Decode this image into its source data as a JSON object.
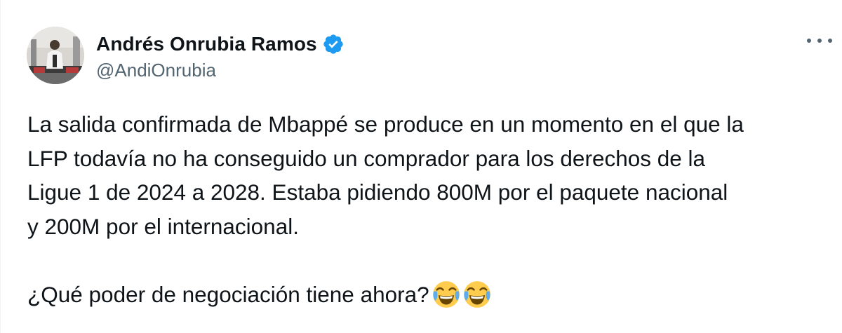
{
  "author": {
    "display_name": "Andrés Onrubia Ramos",
    "handle": "@AndiOnrubia",
    "verified": true,
    "verified_color": "#1d9bf0"
  },
  "menu": {
    "icon": "more-horizontal-icon"
  },
  "tweet": {
    "lines": [
      "La salida confirmada de Mbappé se produce en un momento en el que la",
      "LFP todavía no ha conseguido un comprador para los derechos de la",
      "Ligue 1 de 2024 a 2028. Estaba pidiendo 800M por el paquete nacional",
      "y 200M por el internacional."
    ],
    "question": "¿Qué poder de negociación tiene ahora?",
    "emojis": [
      "face-with-tears-of-joy",
      "face-with-tears-of-joy"
    ]
  },
  "colors": {
    "text": "#0f1419",
    "secondary": "#536471"
  }
}
